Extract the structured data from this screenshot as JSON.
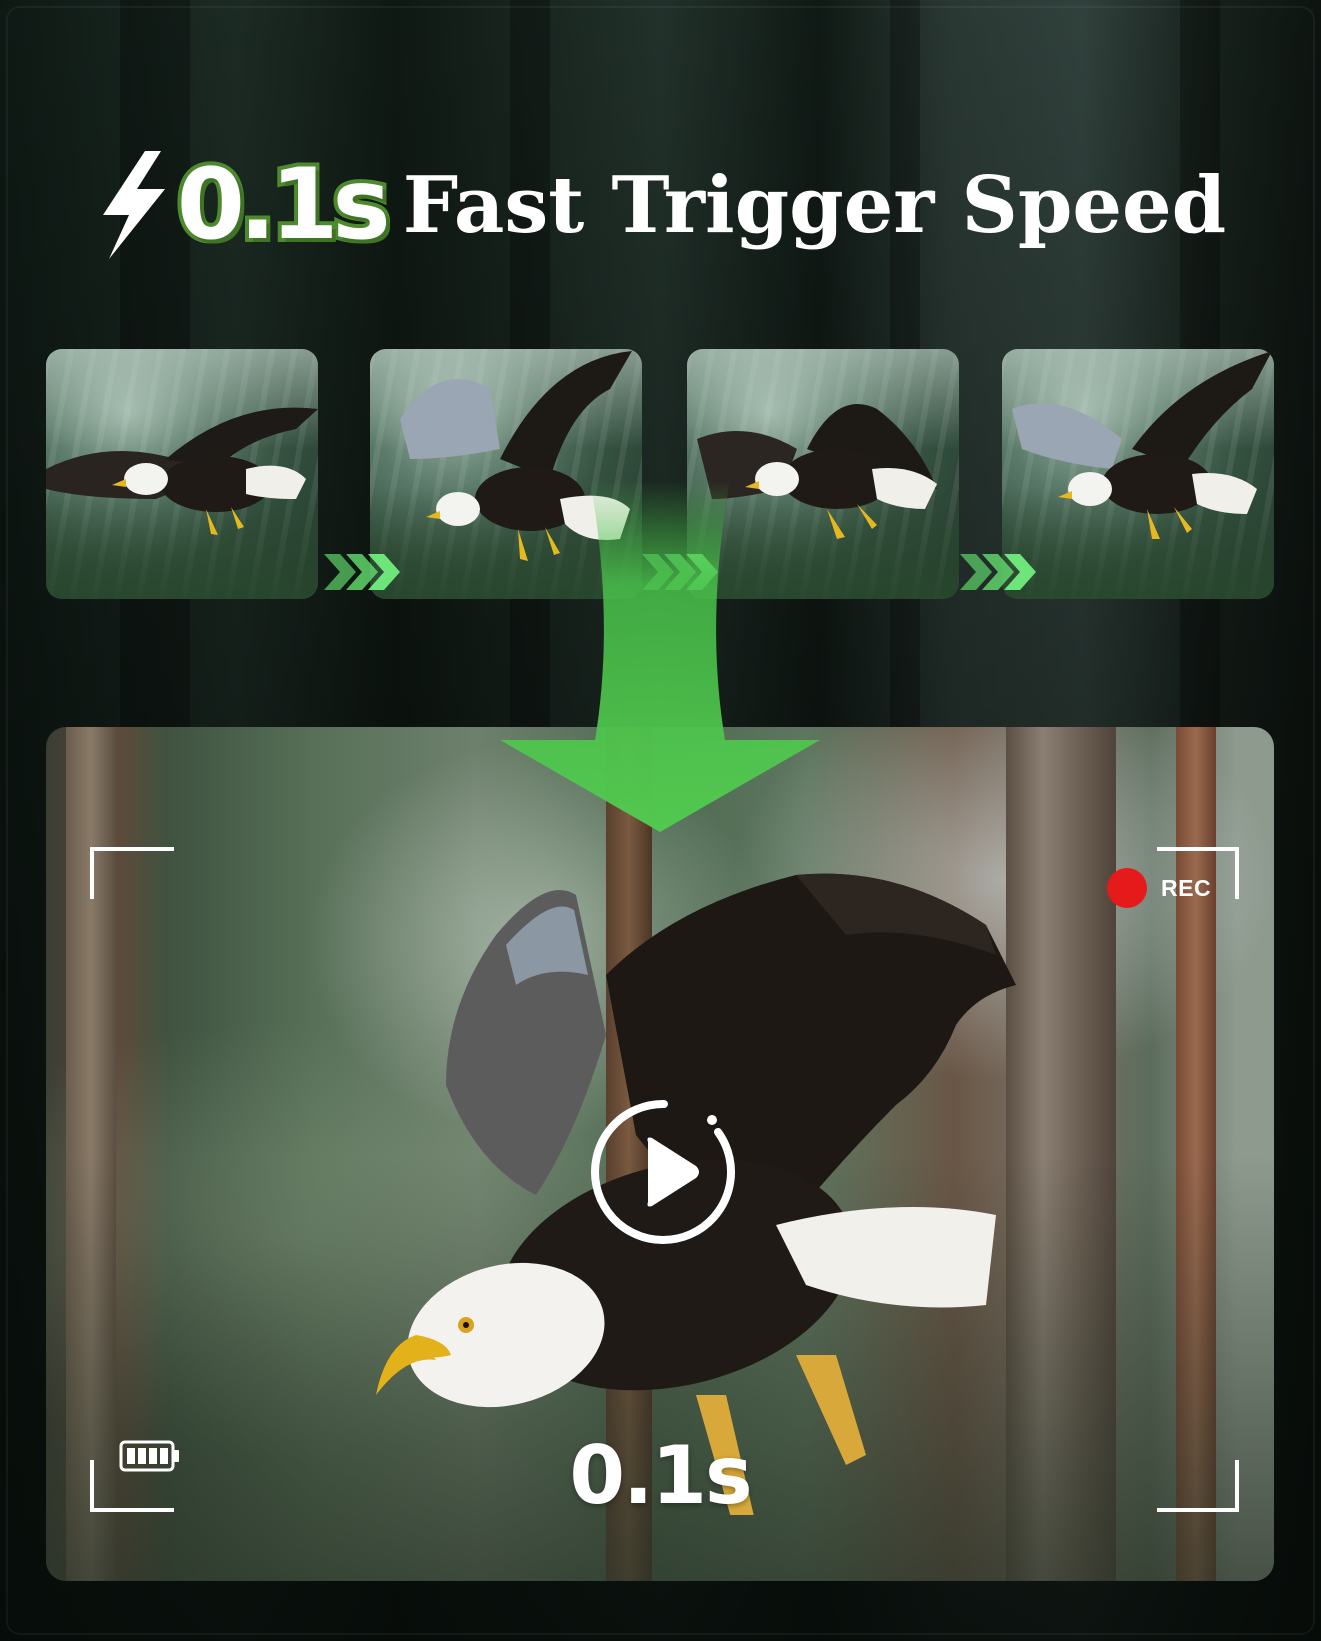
{
  "headline": {
    "speed_value": "0.1s",
    "title": "Fast Trigger Speed"
  },
  "sequence": {
    "frames": [
      "frame-1",
      "frame-2",
      "frame-3",
      "frame-4"
    ]
  },
  "viewfinder": {
    "rec_label": "REC",
    "caption": "0.1s"
  },
  "colors": {
    "accent_green": "#4d8a2d",
    "arrow_green": "#49c14a",
    "rec_red": "#e51b1b"
  },
  "icons": [
    "lightning-icon",
    "chevron-arrow-icon",
    "down-arrow-icon",
    "record-dot-icon",
    "battery-icon",
    "play-icon"
  ]
}
